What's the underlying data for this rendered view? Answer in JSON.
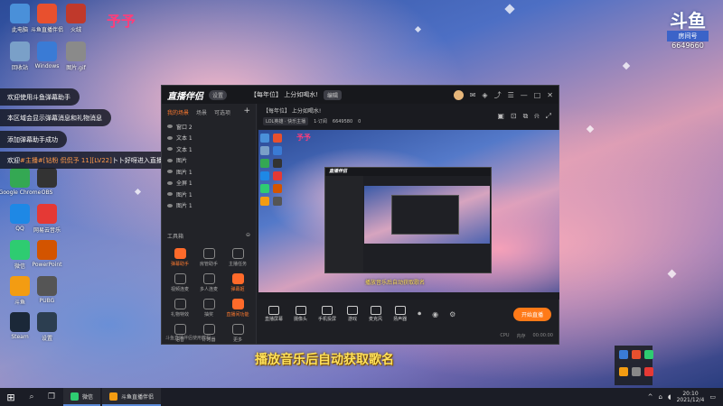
{
  "stamp": "予予",
  "room_badge": {
    "logo": "斗鱼",
    "tag": "房间号",
    "number": "6649660"
  },
  "desktop_icons": [
    {
      "label": "此电脑",
      "icon": "computer-icon",
      "color": "#4a90d9"
    },
    {
      "label": "斗鱼直播伴侣",
      "icon": "douyu-icon",
      "color": "#e8502e"
    },
    {
      "label": "火绒",
      "icon": "antivirus-icon",
      "color": "#c0392b"
    },
    {
      "label": "回收站",
      "icon": "recycle-bin-icon",
      "color": "#7aa0c8"
    },
    {
      "label": "Windows",
      "icon": "windows-icon",
      "color": "#3a7bd5"
    },
    {
      "label": "图片.gif",
      "icon": "image-icon",
      "color": "#8a8a8a"
    },
    {
      "label": "Google Chrome",
      "icon": "chrome-icon",
      "color": "#34a853"
    },
    {
      "label": "OBS",
      "icon": "obs-icon",
      "color": "#333333"
    },
    {
      "label": "QQ",
      "icon": "qq-icon",
      "color": "#1e88e5"
    },
    {
      "label": "网易云音乐",
      "icon": "netease-music-icon",
      "color": "#e53935"
    },
    {
      "label": "微信",
      "icon": "wechat-icon",
      "color": "#2ecc71"
    },
    {
      "label": "PowerPoint",
      "icon": "powerpoint-icon",
      "color": "#d35400"
    },
    {
      "label": "斗鱼",
      "icon": "douyu-live-icon",
      "color": "#f39c12"
    },
    {
      "label": "PUBG",
      "icon": "pubg-icon",
      "color": "#555555"
    },
    {
      "label": "Steam",
      "icon": "steam-icon",
      "color": "#1b2838"
    },
    {
      "label": "设置",
      "icon": "settings-icon",
      "color": "#2c3e50"
    }
  ],
  "notices": [
    {
      "text": "欢迎使用斗鱼弹幕助手"
    },
    {
      "text": "本区域会显示弹幕消息和礼物消息"
    },
    {
      "text": "添加弹幕助手成功"
    },
    {
      "prefix": "欢迎",
      "highlight": "#主播#[钻粉 侃侃予 11][LV22]",
      "suffix": "卜卜好呀进入直播间"
    }
  ],
  "app": {
    "title": "直播伴侣",
    "version": "设置",
    "room_title": "【每年位】 上分如喝水!",
    "edit_label": "编辑",
    "category": "LOL英雄 · 快乐主播",
    "online": "1·订阅",
    "fans": "6649580",
    "hot": "0",
    "tabs": [
      "我的场景",
      "场景",
      "可选项"
    ],
    "sources": [
      "窗口 2",
      "文本 1",
      "文本 1",
      "图片",
      "图片 1",
      "全屏 1",
      "图片 1",
      "图片 1"
    ],
    "tools_title": "工具箱",
    "tools": [
      {
        "label": "弹幕助手",
        "active": true
      },
      {
        "label": "房管助手",
        "active": false
      },
      {
        "label": "主播任务",
        "active": false
      },
      {
        "label": "视频连麦",
        "active": false
      },
      {
        "label": "多人连麦",
        "active": false
      },
      {
        "label": "弹幕姬",
        "active": true
      },
      {
        "label": "礼物特效",
        "active": false
      },
      {
        "label": "抽奖",
        "active": false
      },
      {
        "label": "直播间功能",
        "active": true
      },
      {
        "label": "语音",
        "active": false
      },
      {
        "label": "计时器",
        "active": false
      },
      {
        "label": "更多",
        "active": false
      }
    ],
    "footer": "斗鱼直播伴侣使用教程",
    "preview_name": "予予",
    "preview_yellow_text": "播放音乐后自动获取歌名",
    "controls": [
      "直播屏幕",
      "摄像头",
      "手机投屏",
      "游戏",
      "麦克风",
      "扬声器"
    ],
    "go_live": "开始直播",
    "status": [
      "CPU",
      "内存",
      "00:00:00"
    ]
  },
  "caption": "播放音乐后自动获取歌名",
  "taskbar": {
    "apps": [
      {
        "label": "微信",
        "color": "#2ecc71"
      },
      {
        "label": "斗鱼直播伴侣",
        "color": "#f39c12"
      }
    ],
    "time": "20:10",
    "date": "2021/12/4"
  }
}
